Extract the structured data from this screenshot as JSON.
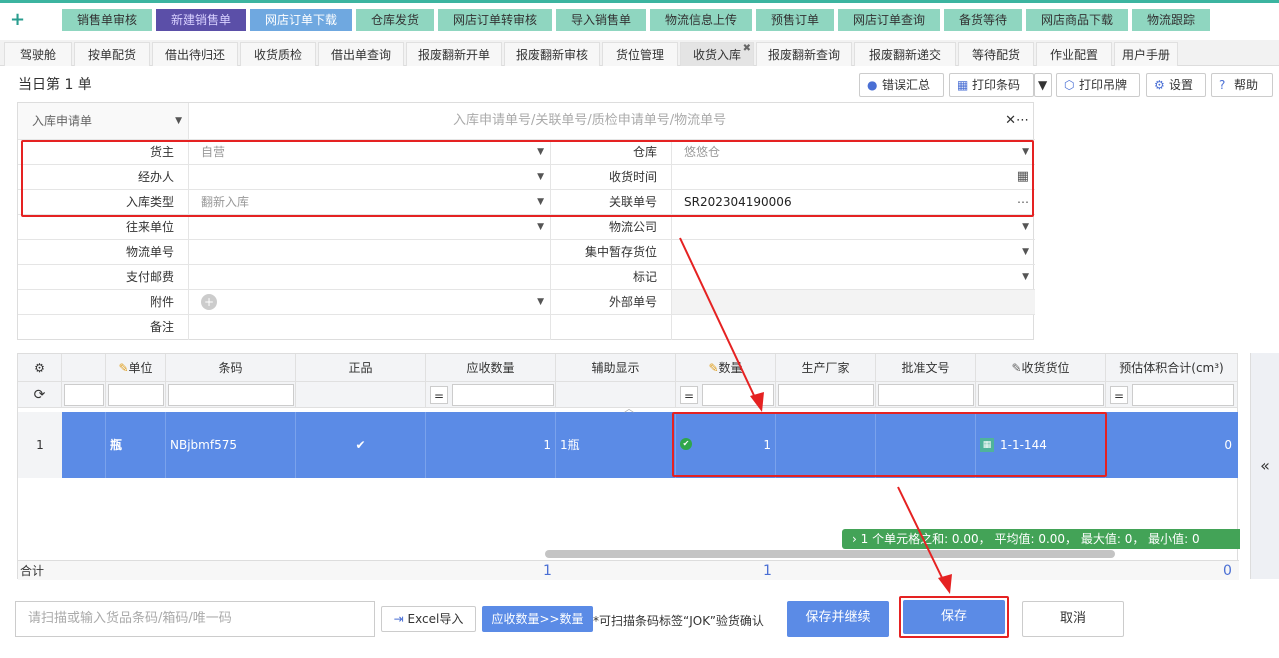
{
  "topnav": {
    "items": [
      "销售单审核",
      "新建销售单",
      "网店订单下载",
      "仓库发货",
      "网店订单转审核",
      "导入销售单",
      "物流信息上传",
      "预售订单",
      "网店订单查询",
      "备货等待",
      "网店商品下载",
      "物流跟踪"
    ]
  },
  "tabs": {
    "items": [
      "驾驶舱",
      "按单配货",
      "借出待归还",
      "收货质检",
      "借出单查询",
      "报废翻新开单",
      "报废翻新审核",
      "货位管理",
      "收货入库",
      "报废翻新查询",
      "报废翻新递交",
      "等待配货",
      "作业配置",
      "用户手册"
    ],
    "active_index": 8
  },
  "header": {
    "day_label": "当日第 1 单",
    "buttons": [
      "错误汇总",
      "打印条码",
      "打印吊牌",
      "设置",
      "帮助"
    ]
  },
  "form": {
    "doc_type": "入库申请单",
    "search_placeholder": "入库申请单号/关联单号/质检申请单号/物流单号",
    "owner_label": "货主",
    "owner_value": "自营",
    "warehouse_label": "仓库",
    "warehouse_value": "悠悠仓",
    "handler_label": "经办人",
    "handler_value": "",
    "receive_time_label": "收货时间",
    "receive_time_value": "",
    "in_type_label": "入库类型",
    "in_type_value": "翻新入库",
    "related_no_label": "关联单号",
    "related_no_value": "SR202304190006",
    "partner_label": "往来单位",
    "logistics_co_label": "物流公司",
    "logistics_no_label": "物流单号",
    "temp_location_label": "集中暂存货位",
    "postage_label": "支付邮费",
    "mark_label": "标记",
    "attachment_label": "附件",
    "external_no_label": "外部单号",
    "remark_label": "备注"
  },
  "grid": {
    "columns": [
      "单位",
      "条码",
      "正品",
      "应收数量",
      "辅助显示",
      "数量",
      "生产厂家",
      "批准文号",
      "收货货位",
      "预估体积合计(cm³)"
    ],
    "filter_eq": "=",
    "row": {
      "index": "1",
      "unit": "瓶",
      "barcode": "NBjbmf575",
      "genuine": "✔",
      "expected_qty": "1",
      "aux": "1瓶",
      "qty": "1",
      "maker": "",
      "approval": "",
      "location": "1-1-144",
      "volume": "0"
    },
    "stats": "1 个单元格之和: 0.00， 平均值: 0.00， 最大值: 0， 最小值: 0",
    "sum_label": "合计",
    "sum_expected": "1",
    "sum_qty": "1",
    "sum_volume": "0"
  },
  "bottom": {
    "scan_placeholder": "请扫描或输入货品条码/箱码/唯一码",
    "excel_import": "Excel导入",
    "copy_qty": "应收数量>>数量",
    "hint": "*可扫描条码标签“JOK”验货确认",
    "save_continue": "保存并继续",
    "save": "保存",
    "cancel": "取消"
  },
  "colors": {
    "accent": "#5b8be6",
    "highlight": "#e52222",
    "nav": "#8fd6c0"
  }
}
